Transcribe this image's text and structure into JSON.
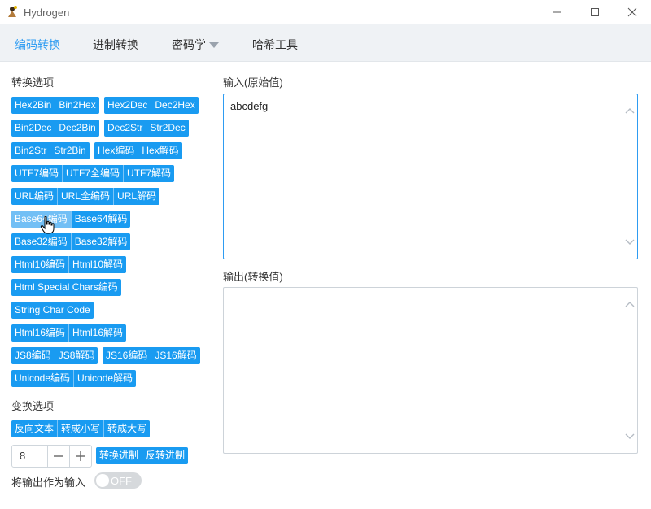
{
  "window": {
    "title": "Hydrogen"
  },
  "menu": {
    "items": [
      {
        "label": "编码转换",
        "active": true
      },
      {
        "label": "进制转换"
      },
      {
        "label": "密码学"
      },
      {
        "label": "哈希工具"
      }
    ]
  },
  "left": {
    "convert_title": "转换选项",
    "groups": [
      [
        "Hex2Bin",
        "Bin2Hex"
      ],
      [
        "Hex2Dec",
        "Dec2Hex"
      ],
      [
        "Bin2Dec",
        "Dec2Bin"
      ],
      [
        "Dec2Str",
        "Str2Dec"
      ],
      [
        "Bin2Str",
        "Str2Bin"
      ],
      [
        "Hex编码",
        "Hex解码"
      ],
      [
        "UTF7编码",
        "UTF7全编码",
        "UTF7解码"
      ],
      [
        "URL编码",
        "URL全编码",
        "URL解码"
      ],
      [
        "Base64编码",
        "Base64解码"
      ],
      [
        "Base32编码",
        "Base32解码"
      ],
      [
        "Html10编码",
        "Html10解码"
      ],
      [
        "Html Special Chars编码"
      ],
      [
        "String Char Code"
      ],
      [
        "Html16编码",
        "Html16解码"
      ],
      [
        "JS8编码",
        "JS8解码"
      ],
      [
        "JS16编码",
        "JS16解码"
      ],
      [
        "Unicode编码",
        "Unicode解码"
      ]
    ],
    "transform_title": "变换选项",
    "transform_buttons": [
      "反向文本",
      "转成小写",
      "转成大写"
    ],
    "stepper_value": "8",
    "base_buttons": [
      "转换进制",
      "反转进制"
    ],
    "toggle_label": "将输出作为输入",
    "toggle_state": "OFF"
  },
  "right": {
    "input_label": "输入(原始值)",
    "input_value": "abcdefg",
    "output_label": "输出(转换值)",
    "output_value": ""
  },
  "colors": {
    "accent": "#199bf1",
    "active_menu": "#2e9cf2",
    "menubar": "#eff2f5"
  }
}
